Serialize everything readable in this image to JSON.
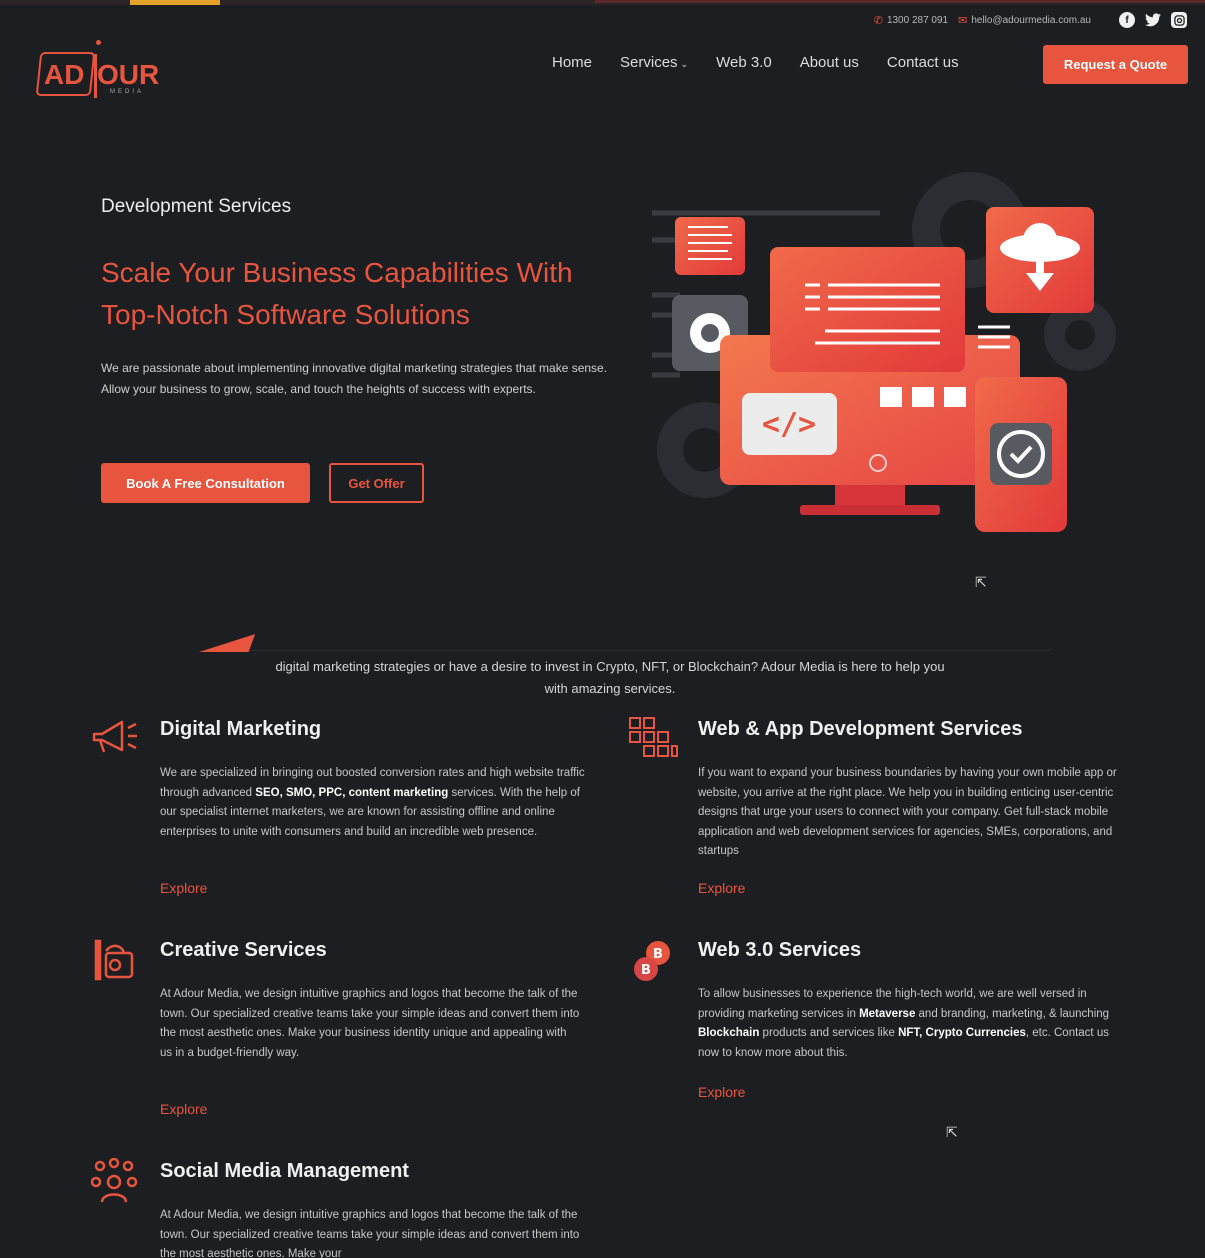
{
  "colors": {
    "accent": "#e8553e",
    "background": "#1d1e22"
  },
  "topbar": {
    "phone": "1300 287 091",
    "email": "hello@adourmedia.com.au",
    "social": [
      "facebook-icon",
      "twitter-icon",
      "instagram-icon"
    ]
  },
  "header": {
    "logo_left": "AD",
    "logo_right": "OUR",
    "logo_sub": "MEDIA",
    "nav": [
      "Home",
      "Services",
      "Web 3.0",
      "About us",
      "Contact us"
    ],
    "quote_button": "Request a Quote"
  },
  "hero": {
    "subtitle": "Development Services",
    "title_line1": "Scale Your Business Capabilities With",
    "title_line2": "Top-Notch Software Solutions",
    "description": "We are passionate about implementing innovative digital marketing strategies that make sense. Allow your business to grow, scale, and touch the heights of success with experts.",
    "primary_button": "Book A Free Consultation",
    "secondary_button": "Get Offer"
  },
  "intro": {
    "line1": "digital marketing strategies or have a desire to invest in Crypto, NFT, or Blockchain? Adour Media is here to help you",
    "line2": "with amazing services."
  },
  "services": {
    "explore_label": "Explore",
    "digital_marketing": {
      "title": "Digital Marketing",
      "desc_a": "We are specialized in bringing out boosted conversion rates and high website traffic through advanced ",
      "desc_b": "SEO, SMO, PPC, content marketing",
      "desc_c": " services. With the help of our specialist internet marketers, we are known for assisting offline and online enterprises to unite with consumers and build an incredible web presence."
    },
    "web_app": {
      "title": "Web & App Development Services",
      "desc": "If you want to expand your business boundaries by having your own mobile app or website, you arrive at the right place. We help you in building enticing user-centric designs that urge your users to connect with your company. Get full-stack mobile application and web development services for agencies, SMEs, corporations, and startups"
    },
    "creative": {
      "title": "Creative Services",
      "desc": "At Adour Media, we design intuitive graphics and logos that become the talk of the town. Our specialized creative teams take your simple ideas and convert them into the most aesthetic ones. Make your business identity unique and appealing with us in a budget-friendly way."
    },
    "web3": {
      "title": "Web 3.0 Services",
      "desc_a": "To allow businesses to experience the high-tech world, we are well versed in providing marketing services in ",
      "desc_b": "Metaverse",
      "desc_c": " and branding, marketing, & launching ",
      "desc_d": "Blockchain",
      "desc_e": " products and services like ",
      "desc_f": "NFT, Crypto Currencies",
      "desc_g": ", etc. Contact us now to know more about this."
    },
    "social": {
      "title": "Social Media Management",
      "desc": "At Adour Media, we design intuitive graphics and logos that become the talk of the town. Our specialized creative teams take your simple ideas and convert them into the most aesthetic ones. Make your"
    }
  }
}
